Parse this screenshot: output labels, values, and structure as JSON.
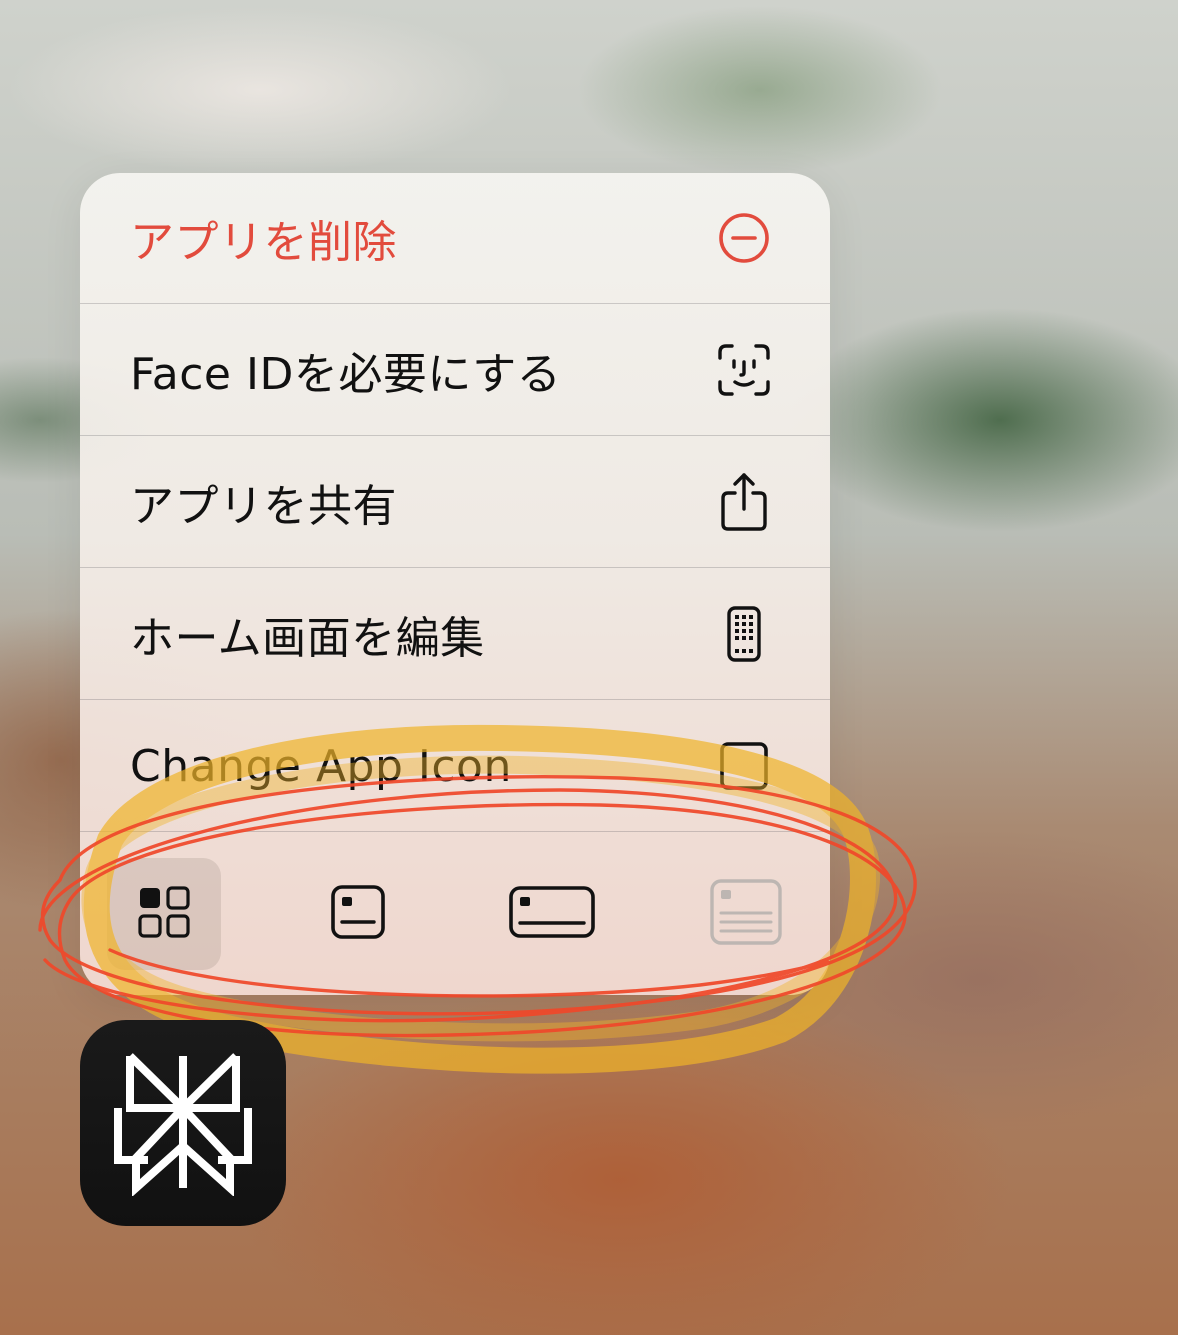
{
  "menu": {
    "items": [
      {
        "label": "アプリを削除",
        "icon": "minus-circle-icon",
        "destructive": true
      },
      {
        "label": "Face IDを必要にする",
        "icon": "face-id-icon"
      },
      {
        "label": "アプリを共有",
        "icon": "share-icon"
      },
      {
        "label": "ホーム画面を編集",
        "icon": "phone-apps-icon"
      },
      {
        "label": "Change App Icon",
        "icon": "square-icon"
      }
    ],
    "size_options": [
      {
        "icon": "small-widget-grid-icon",
        "selected": true
      },
      {
        "icon": "medium-widget-icon",
        "selected": false
      },
      {
        "icon": "wide-widget-icon",
        "selected": false
      },
      {
        "icon": "large-widget-icon",
        "selected": false,
        "disabled": true
      }
    ]
  },
  "colors": {
    "destructive": "#e24b3d",
    "highlight_yellow": "#f0b429",
    "annotation_red": "#f0482a"
  },
  "app_icon": {
    "icon": "perplexity-logo-icon"
  }
}
